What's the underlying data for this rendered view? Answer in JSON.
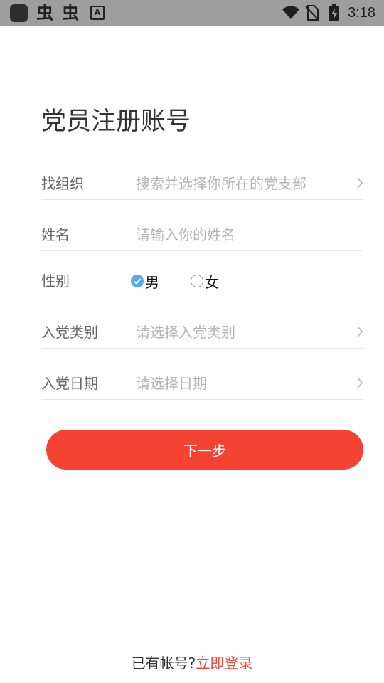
{
  "status_bar": {
    "time": "3:18",
    "icons": [
      "app-square-icon",
      "bug-icon",
      "bug-icon",
      "accessibility-a-icon",
      "wifi-icon",
      "no-sim-icon",
      "battery-charging-icon"
    ],
    "bug_glyph": "虫",
    "a_glyph": "A"
  },
  "page": {
    "title": "党员注册账号"
  },
  "form": {
    "organization": {
      "label": "找组织",
      "placeholder": "搜索并选择你所在的党支部"
    },
    "name": {
      "label": "姓名",
      "placeholder": "请输入你的姓名"
    },
    "gender": {
      "label": "性别",
      "options": [
        {
          "label": "男",
          "selected": true
        },
        {
          "label": "女",
          "selected": false
        }
      ]
    },
    "party_type": {
      "label": "入党类别",
      "placeholder": "请选择入党类别"
    },
    "join_date": {
      "label": "入党日期",
      "placeholder": "请选择日期"
    }
  },
  "actions": {
    "next_label": "下一步"
  },
  "footer": {
    "prompt": "已有帐号?",
    "login_link": "立即登录"
  },
  "colors": {
    "accent": "#f44333",
    "radio_checked": "#5aa9f0",
    "status_bar_bg": "#9e9e9e"
  }
}
